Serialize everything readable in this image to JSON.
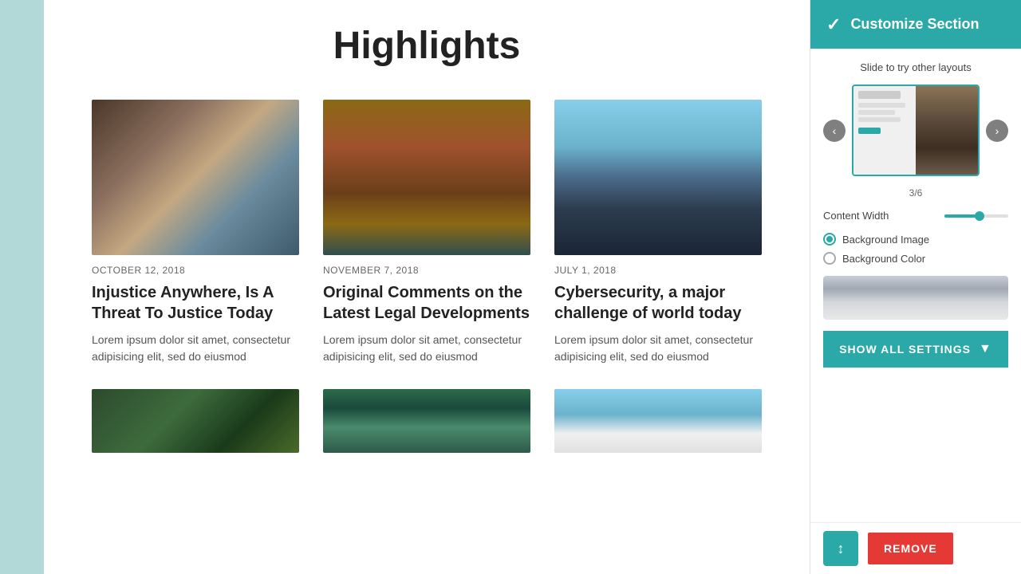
{
  "page": {
    "title": "Highlights"
  },
  "articles": [
    {
      "date": "OCTOBER 12, 2018",
      "title": "Injustice Anywhere, Is A Threat To Justice Today",
      "excerpt": "Lorem ipsum dolor sit amet, consectetur adipisicing elit, sed do eiusmod",
      "imageClass": "img-1"
    },
    {
      "date": "NOVEMBER 7, 2018",
      "title": "Original Comments on the Latest Legal Developments",
      "excerpt": "Lorem ipsum dolor sit amet, consectetur adipisicing elit, sed do eiusmod",
      "imageClass": "img-2"
    },
    {
      "date": "JULY 1, 2018",
      "title": "Cybersecurity, a major challenge of world today",
      "excerpt": "Lorem ipsum dolor sit amet, consectetur adipisicing elit, sed do eiusmod",
      "imageClass": "img-3"
    }
  ],
  "second_row_images": [
    "img-4",
    "img-5",
    "img-6"
  ],
  "panel": {
    "title": "Customize Section",
    "slide_label": "Slide to try other layouts",
    "carousel_counter": "3/6",
    "content_width_label": "Content Width",
    "background_image_label": "Background Image",
    "background_color_label": "Background Color",
    "show_all_label": "SHOW ALL SETTINGS",
    "remove_label": "REMOVE"
  }
}
